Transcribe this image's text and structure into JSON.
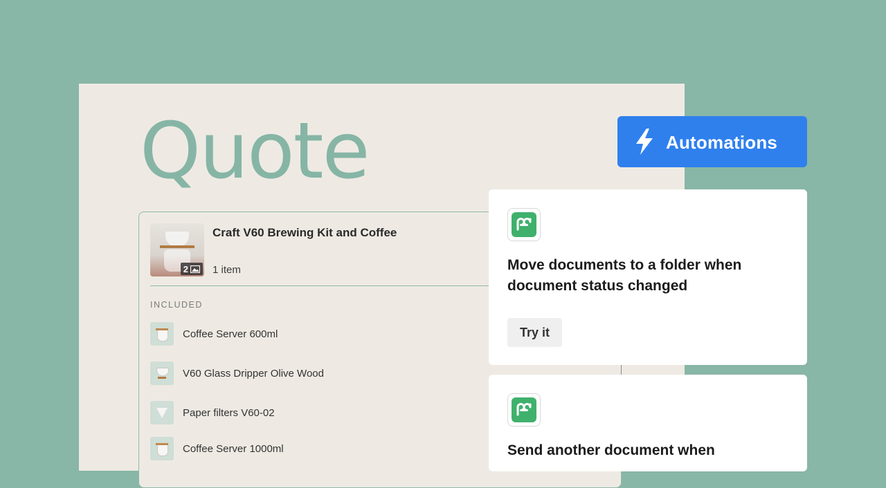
{
  "quote": {
    "title": "Quote",
    "product": {
      "name": "Craft V60 Brewing Kit and Coffee",
      "quantity": "1 item",
      "image_count": "2"
    },
    "included_label": "INCLUDED",
    "included_items": [
      {
        "label": "Coffee Server 600ml",
        "icon": "coffee-server-icon"
      },
      {
        "label": "V60 Glass Dripper Olive Wood",
        "icon": "dripper-icon"
      },
      {
        "label": "Paper filters V60-02",
        "icon": "paper-filter-icon"
      },
      {
        "label": "Coffee Server 1000ml",
        "icon": "coffee-server-icon"
      }
    ]
  },
  "automations": {
    "button_label": "Automations",
    "cards": [
      {
        "title": "Move documents to a folder when document status changed",
        "action_label": "Try it",
        "icon": "pandadoc-logo"
      },
      {
        "title": "Send another document when",
        "icon": "pandadoc-logo"
      }
    ]
  },
  "colors": {
    "background": "#88b6a7",
    "document": "#eeeae3",
    "accent_green": "#86b5a6",
    "primary_blue": "#2f80ed",
    "logo_green": "#3fb16c"
  }
}
